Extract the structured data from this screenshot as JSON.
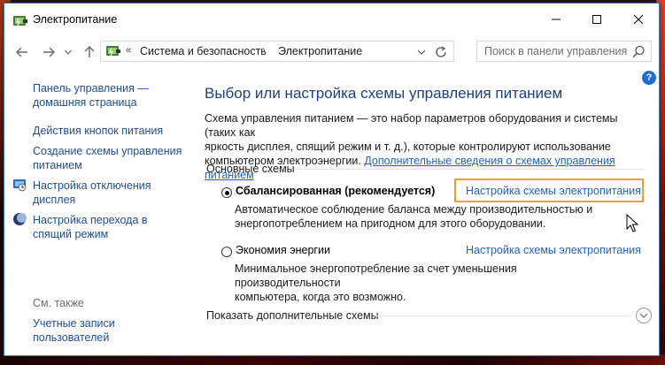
{
  "window": {
    "title": "Электропитание"
  },
  "address_bar": {
    "overflow": "«",
    "crumbs": [
      "Система и безопасность",
      "Электропитание"
    ],
    "separator": "›"
  },
  "search": {
    "placeholder": "Поиск в панели управления"
  },
  "left_pane": {
    "home_link_line1": "Панель управления —",
    "home_link_line2": "домашняя страница",
    "power_buttons": "Действия кнопок питания",
    "create_plan_line1": "Создание схемы управления",
    "create_plan_line2": "питанием",
    "display_off_line1": "Настройка отключения",
    "display_off_line2": "дисплея",
    "sleep_line1": "Настройка перехода в",
    "sleep_line2": "спящий режим",
    "see_also": "См. также",
    "accounts_line1": "Учетные записи",
    "accounts_line2": "пользователей"
  },
  "main": {
    "help": "?",
    "heading": "Выбор или настройка схемы управления питанием",
    "desc_line1": "Схема управления питанием — это набор параметров оборудования и системы (таких как",
    "desc_line2": "яркость дисплея, спящий режим и т. д.), которые контролируют использование",
    "desc_line3_text": "компьютером электроэнергии. ",
    "desc_link": "Дополнительные сведения о схемах управления питанием",
    "group_label": "Основные схемы",
    "plans": [
      {
        "name": "Сбалансированная (рекомендуется)",
        "link": "Настройка схемы электропитания",
        "desc_line1": "Автоматическое соблюдение баланса между производительностью и",
        "desc_line2": "энергопотреблением на пригодном для этого оборудовании.",
        "selected": true
      },
      {
        "name": "Экономия энергии",
        "link": "Настройка схемы электропитания",
        "desc_line1": "Минимальное энергопотребление за счет уменьшения производительности",
        "desc_line2": "компьютера, когда это возможно.",
        "selected": false
      }
    ],
    "show_more": "Показать дополнительные схемы"
  },
  "colors": {
    "link": "#1f62c4",
    "heading": "#1e3f82",
    "highlight": "#f0a030"
  }
}
